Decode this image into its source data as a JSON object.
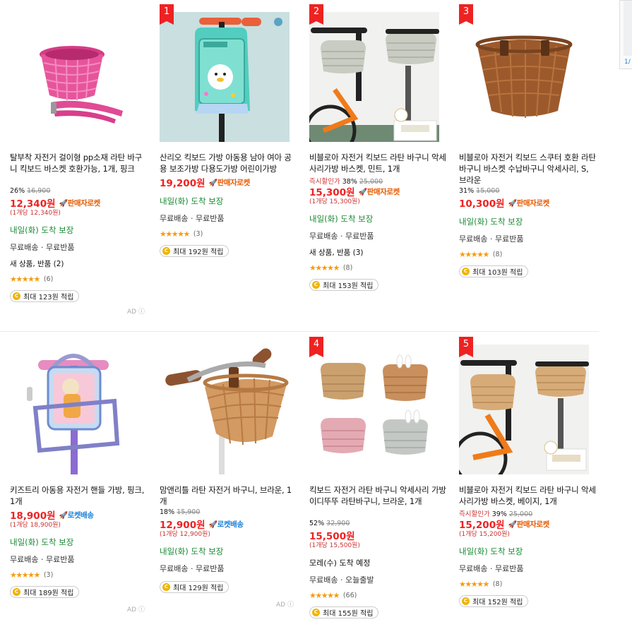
{
  "products": [
    {
      "title": "탈부착 자전거 걸이형 pp소재 라탄 바구니 킥보드 바스켓 호환가능, 1개, 핑크",
      "rank": "",
      "discount": "26%",
      "old_price": "16,900",
      "instant": "",
      "price": "12,340원",
      "badge": "판매자로켓",
      "unit": "(1개당 12,340원)",
      "arrival": "내일(화) 도착 보장",
      "shipping": "무료배송 · 무료반품",
      "newused": "새 상품, 반품 (2)",
      "stars": "★★★★★",
      "reviews": "(6)",
      "points": "최대 123원 적립",
      "ad": "AD ⓘ"
    },
    {
      "title": "산리오 킥보드 가방 아동용 남아 여아 공용 보조가방 다용도가방 어린이가방",
      "rank": "1",
      "discount": "",
      "old_price": "",
      "instant": "",
      "price": "19,200원",
      "badge": "판매자로켓",
      "unit": "",
      "arrival": "내일(화) 도착 보장",
      "shipping": "무료배송 · 무료반품",
      "newused": "",
      "stars": "★★★★★",
      "reviews": "(3)",
      "points": "최대 192원 적립",
      "ad": ""
    },
    {
      "title": "비블로아 자전거 킥보드 라탄 바구니 악세사리가방 바스켓, 민트, 1개",
      "rank": "2",
      "discount": "38%",
      "old_price": "25,000",
      "instant": "즉시할인가",
      "price": "15,300원",
      "badge": "판매자로켓",
      "unit": "(1개당 15,300원)",
      "arrival": "내일(화) 도착 보장",
      "shipping": "무료배송 · 무료반품",
      "newused": "새 상품, 반품 (3)",
      "stars": "★★★★★",
      "reviews": "(8)",
      "points": "최대 153원 적립",
      "ad": ""
    },
    {
      "title": "비블로아 자전거 킥보드 스쿠터 호환 라탄바구니 바스켓 수납바구니 악세사리, S, 브라운",
      "rank": "3",
      "discount": "31%",
      "old_price": "15,000",
      "instant": "",
      "price": "10,300원",
      "badge": "판매자로켓",
      "unit": "",
      "arrival": "내일(화) 도착 보장",
      "shipping": "무료배송 · 무료반품",
      "newused": "",
      "stars": "★★★★★",
      "reviews": "(8)",
      "points": "최대 103원 적립",
      "ad": ""
    },
    {
      "title": "키즈트리 아동용 자전거 핸들 가방, 핑크, 1개",
      "rank": "",
      "discount": "",
      "old_price": "",
      "instant": "",
      "price": "18,900원",
      "badge": "로켓배송",
      "unit": "(1개당 18,900원)",
      "arrival": "내일(화) 도착 보장",
      "shipping": "무료배송 · 무료반품",
      "newused": "",
      "stars": "★★★★★",
      "reviews": "(3)",
      "points": "최대 189원 적립",
      "ad": "AD ⓘ"
    },
    {
      "title": "맘앤리틀 라탄 자전거 바구니, 브라운, 1개",
      "rank": "",
      "discount": "18%",
      "old_price": "15,900",
      "instant": "",
      "price": "12,900원",
      "badge": "로켓배송",
      "unit": "(1개당 12,900원)",
      "arrival": "내일(화) 도착 보장",
      "shipping": "무료배송 · 무료반품",
      "newused": "",
      "stars": "★★★★★",
      "reviews": "",
      "points": "최대 129원 적립",
      "ad": "AD ⓘ"
    },
    {
      "title": "킥보드 자전거 라탄 바구니 악세사리 가방 이디뚜뚜 라탄바구니, 브라운, 1개",
      "rank": "4",
      "discount": "52%",
      "old_price": "32,900",
      "instant": "",
      "price": "15,500원",
      "badge": "",
      "unit": "(1개당 15,500원)",
      "arrival": "모레(수) 도착 예정",
      "shipping": "무료배송 · 오늘출발",
      "newused": "",
      "stars": "★★★★★",
      "reviews": "(66)",
      "points": "최대 155원 적립",
      "ad": ""
    },
    {
      "title": "비블로아 자전거 킥보드 라탄 바구니 악세사리가방 바스켓, 베이지, 1개",
      "rank": "5",
      "discount": "39%",
      "old_price": "25,000",
      "instant": "즉시할인가",
      "price": "15,200원",
      "badge": "판매자로켓",
      "unit": "(1개당 15,200원)",
      "arrival": "내일(화) 도착 보장",
      "shipping": "무료배송 · 무료반품",
      "newused": "",
      "stars": "★★★★★",
      "reviews": "(8)",
      "points": "최대 152원 적립",
      "ad": ""
    }
  ],
  "side_panel": {
    "page": "1/"
  },
  "colors": {
    "price": "#e22222",
    "arrival": "#1a8a33",
    "seller_rocket": "#e65a00",
    "rocket": "#1b7fd8",
    "rank": "#e22222"
  }
}
